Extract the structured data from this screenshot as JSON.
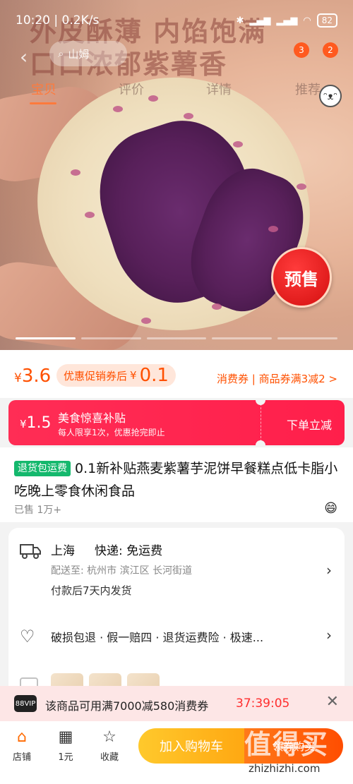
{
  "status_bar": {
    "time": "10:20",
    "network": "0.2K/s",
    "battery": "82"
  },
  "hero": {
    "headline_1": "外皮酥薄 内馅饱满",
    "headline_2": "口口浓郁紫薯香",
    "presale": "预售",
    "slide_count": 5
  },
  "nav": {
    "back_icon": "back-arrow-icon",
    "search_text": "山姆",
    "badge_1": "3",
    "badge_2": "2",
    "tabs": [
      {
        "label": "宝贝",
        "active": true
      },
      {
        "label": "评价",
        "active": false
      },
      {
        "label": "详情",
        "active": false
      },
      {
        "label": "推荐",
        "active": false
      }
    ]
  },
  "price": {
    "currency": "¥",
    "value": "3.6",
    "after_label": "优惠促销券后",
    "after_currency": "¥",
    "after_value": "0.1",
    "coupon_link": "消费券 | 商品券满3减2 >"
  },
  "subsidy": {
    "currency": "¥",
    "amount": "1.5",
    "title": "美食惊喜补贴",
    "subtitle": "每人限享1次，优惠抢完即止",
    "action": "下单立减"
  },
  "product": {
    "tag": "退货包运费",
    "title": "0.1新补贴燕麦紫薯芋泥饼早餐糕点低卡脂小吃晚上零食休闲食品",
    "sold": "已售 1万+"
  },
  "shipping": {
    "city": "上海",
    "express": "快递: 免运费",
    "deliver_to": "配送至: 杭州市 滨江区 长河街道",
    "dispatch": "付款后7天内发货",
    "promises": "破损包退 · 假一赔四 · 退货运费险 · 极速..."
  },
  "vip": {
    "logo": "88VIP",
    "text": "该商品可用满7000减580消费券",
    "timer": "37:39:05"
  },
  "bottom_bar": {
    "store": "店铺",
    "one_yuan": "1元",
    "favorite": "收藏",
    "add_to_cart": "加入购物车",
    "buy_now": "领券购买"
  },
  "watermark": {
    "logo": "值得买",
    "url": "zhizhizhi.com"
  }
}
